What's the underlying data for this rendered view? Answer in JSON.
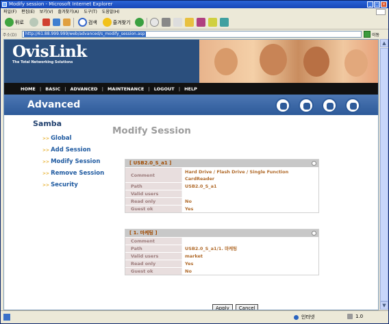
{
  "window": {
    "title": "Modify session - Microsoft Internet Explorer",
    "menu": [
      "파일(F)",
      "편집(E)",
      "보기(V)",
      "즐겨찾기(A)",
      "도구(T)",
      "도움말(H)"
    ],
    "toolbar": {
      "back": "뒤로",
      "search": "검색",
      "favorites": "즐겨찾기"
    },
    "address_label": "주소(D)",
    "address": "http://61.88.999.999/web/advanced/s_modify_session.asp",
    "go_label": "이동",
    "status_zone": "인터넷",
    "status_version": "1.0"
  },
  "banner": {
    "brand": "OvisLink",
    "tagline": "The Total Networking Solutions",
    "nav": [
      "HOME",
      "BASIC",
      "ADVANCED",
      "MAINTENANCE",
      "LOGOUT",
      "HELP"
    ]
  },
  "section": {
    "title": "Advanced"
  },
  "sidebar": {
    "heading": "Samba",
    "items": [
      {
        "label": "Global"
      },
      {
        "label": "Add Session"
      },
      {
        "label": "Modify Session"
      },
      {
        "label": "Remove Session"
      },
      {
        "label": "Security"
      }
    ]
  },
  "page_title": "Modify Session",
  "sessions": [
    {
      "header": "[ USB2.0_S_a1 ]",
      "rows": [
        {
          "key": "Comment",
          "value": "Hard Drive / Flash Drive / Single Function CardReader"
        },
        {
          "key": "Path",
          "value": "USB2.0_S_a1"
        },
        {
          "key": "Valid users",
          "value": ""
        },
        {
          "key": "Read only",
          "value": "No"
        },
        {
          "key": "Guest ok",
          "value": "Yes"
        }
      ]
    },
    {
      "header": "[ 1. 마케팅 ]",
      "rows": [
        {
          "key": "Comment",
          "value": ""
        },
        {
          "key": "Path",
          "value": "USB2.0_S_a1/1. 마케팅"
        },
        {
          "key": "Valid users",
          "value": "market"
        },
        {
          "key": "Read only",
          "value": "Yes"
        },
        {
          "key": "Guest ok",
          "value": "No"
        }
      ]
    }
  ],
  "buttons": {
    "apply": "Apply",
    "cancel": "Cancel"
  },
  "colors": {
    "banner": "#2b4f7d",
    "nav": "#111111",
    "section": "#3c68a7",
    "link": "#1f5aa0",
    "value": "#b06a2a"
  }
}
